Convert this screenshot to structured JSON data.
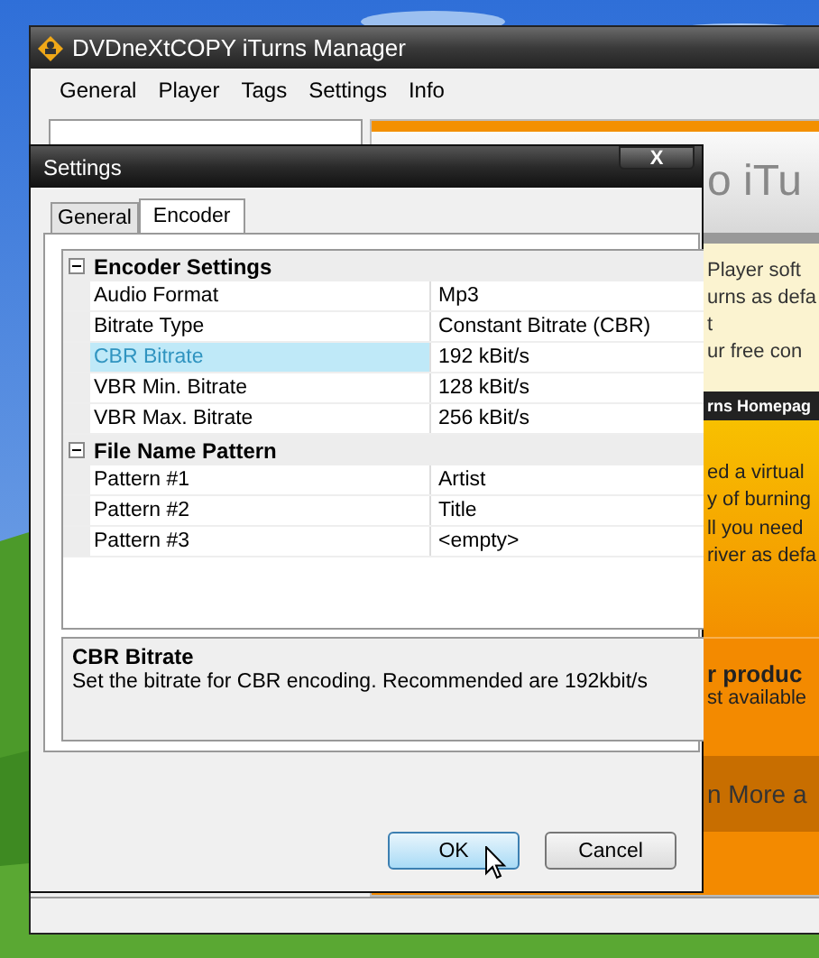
{
  "main_window": {
    "title": "DVDneXtCOPY iTurns Manager",
    "menu": [
      "General",
      "Player",
      "Tags",
      "Settings",
      "Info"
    ],
    "web_panel": [
      {
        "kind": "heading",
        "lines": [
          "o iTu"
        ]
      },
      {
        "kind": "note",
        "lines": [
          "Player soft",
          "urns as defa",
          "t",
          "ur free con"
        ]
      },
      {
        "kind": "bar",
        "lines": [
          "rns Homepag"
        ]
      },
      {
        "kind": "promo",
        "lines": [
          "ed a virtual",
          "y of burning",
          "ll you need",
          "river as defa"
        ]
      },
      {
        "kind": "product",
        "lines": [
          "r produc",
          "st available"
        ]
      },
      {
        "kind": "link-bar",
        "lines": [
          "n More a"
        ]
      }
    ]
  },
  "dialog": {
    "title": "Settings",
    "close": "X",
    "tabs": [
      {
        "label": "General",
        "selected": false
      },
      {
        "label": "Encoder",
        "selected": true
      }
    ],
    "categories": [
      {
        "title": "Encoder Settings",
        "expanded": true,
        "rows": [
          {
            "name": "Audio Format",
            "value": "Mp3",
            "selected": false
          },
          {
            "name": "Bitrate Type",
            "value": "Constant Bitrate (CBR)",
            "selected": false
          },
          {
            "name": "CBR Bitrate",
            "value": "192 kBit/s",
            "selected": true
          },
          {
            "name": "VBR Min. Bitrate",
            "value": "128 kBit/s",
            "selected": false
          },
          {
            "name": "VBR Max. Bitrate",
            "value": "256 kBit/s",
            "selected": false
          }
        ]
      },
      {
        "title": "File Name Pattern",
        "expanded": true,
        "rows": [
          {
            "name": "Pattern #1",
            "value": "Artist",
            "selected": false
          },
          {
            "name": "Pattern #2",
            "value": "Title",
            "selected": false
          },
          {
            "name": "Pattern #3",
            "value": "<empty>",
            "selected": false
          }
        ]
      }
    ],
    "description": {
      "title": "CBR Bitrate",
      "text": "Set the bitrate for CBR encoding. Recommended are 192kbit/s"
    },
    "buttons": [
      {
        "label": "OK",
        "default": true
      },
      {
        "label": "Cancel",
        "default": false
      }
    ]
  }
}
